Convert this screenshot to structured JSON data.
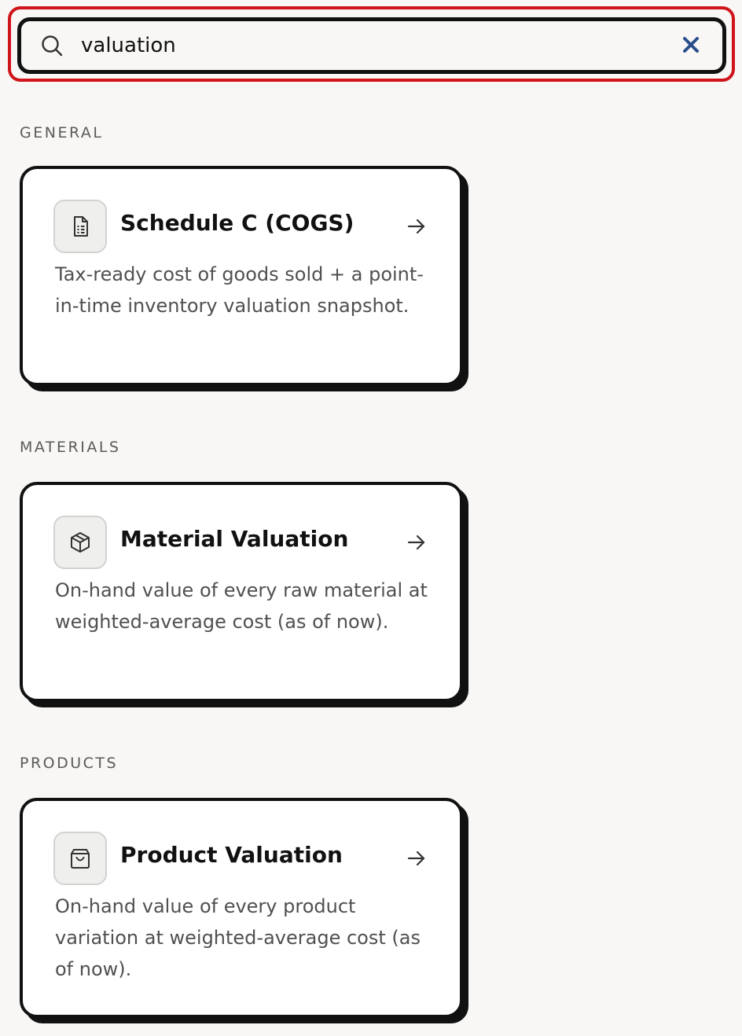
{
  "search": {
    "value": "valuation",
    "focus_color": "#d0141a"
  },
  "sections": [
    {
      "label": "GENERAL",
      "card": {
        "icon": "document-icon",
        "title": "Schedule C (COGS)",
        "description": "Tax-ready cost of goods sold + a point-in-time inventory valuation snapshot."
      }
    },
    {
      "label": "MATERIALS",
      "card": {
        "icon": "box-icon",
        "title": "Material Valuation",
        "description": "On-hand value of every raw material at weighted-average cost (as of now)."
      }
    },
    {
      "label": "PRODUCTS",
      "card": {
        "icon": "shopping-bag-icon",
        "title": "Product Valuation",
        "description": "On-hand value of every product variation at weighted-average cost (as of now)."
      }
    }
  ],
  "colors": {
    "background": "#f8f7f5",
    "card_border": "#111111",
    "clear_icon": "#2a4e8c"
  }
}
